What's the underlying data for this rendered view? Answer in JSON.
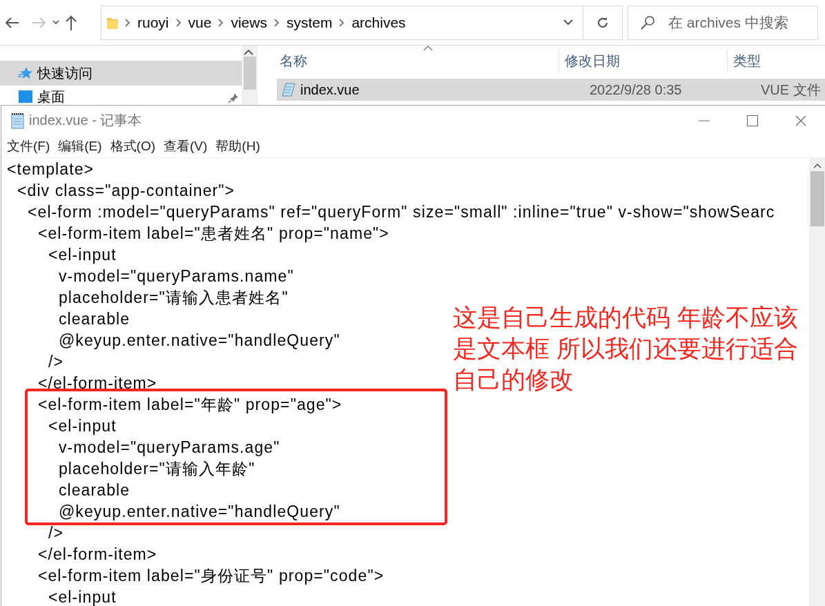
{
  "explorer": {
    "breadcrumb": [
      "ruoyi",
      "vue",
      "views",
      "system",
      "archives"
    ],
    "search": {
      "placeholder": "在 archives 中搜索"
    },
    "nav_items": [
      {
        "label": "快速访问",
        "selected": true
      },
      {
        "label": "桌面",
        "selected": false
      }
    ],
    "columns": [
      "名称",
      "修改日期",
      "类型"
    ],
    "files": [
      {
        "name": "index.vue",
        "modified": "2022/9/28 0:35",
        "type": "VUE 文件",
        "selected": true
      }
    ]
  },
  "notepad": {
    "title": "index.vue - 记事本",
    "menu": [
      "文件(F)",
      "编辑(E)",
      "格式(O)",
      "查看(V)",
      "帮助(H)"
    ],
    "lines": [
      {
        "text": "<template>",
        "highlighted": false
      },
      {
        "text": "  <div class=\"app-container\">",
        "highlighted": false
      },
      {
        "text": "    <el-form :model=\"queryParams\" ref=\"queryForm\" size=\"small\" :inline=\"true\" v-show=\"showSearc",
        "highlighted": false
      },
      {
        "text": "      <el-form-item label=\"患者姓名\" prop=\"name\">",
        "highlighted": false
      },
      {
        "text": "        <el-input",
        "highlighted": false
      },
      {
        "text": "          v-model=\"queryParams.name\"",
        "highlighted": false
      },
      {
        "text": "          placeholder=\"请输入患者姓名\"",
        "highlighted": false
      },
      {
        "text": "          clearable",
        "highlighted": false
      },
      {
        "text": "          @keyup.enter.native=\"handleQuery\"",
        "highlighted": false
      },
      {
        "text": "        />",
        "highlighted": false
      },
      {
        "text": "      </el-form-item>",
        "highlighted": false
      },
      {
        "text": "      <el-form-item label=\"年龄\" prop=\"age\">",
        "highlighted": true
      },
      {
        "text": "        <el-input",
        "highlighted": true
      },
      {
        "text": "          v-model=\"queryParams.age\"",
        "highlighted": true
      },
      {
        "text": "          placeholder=\"请输入年龄\"",
        "highlighted": true
      },
      {
        "text": "          clearable",
        "highlighted": true
      },
      {
        "text": "          @keyup.enter.native=\"handleQuery\"",
        "highlighted": true
      },
      {
        "text": "        />",
        "highlighted": false
      },
      {
        "text": "      </el-form-item>",
        "highlighted": false
      },
      {
        "text": "      <el-form-item label=\"身份证号\" prop=\"code\">",
        "highlighted": false
      },
      {
        "text": "        <el-input",
        "highlighted": false
      }
    ],
    "annotation": {
      "lines": [
        "这是自己生成的代码 年龄不应该",
        "是文本框 所以我们还要进行适合",
        "自己的修改"
      ]
    }
  }
}
